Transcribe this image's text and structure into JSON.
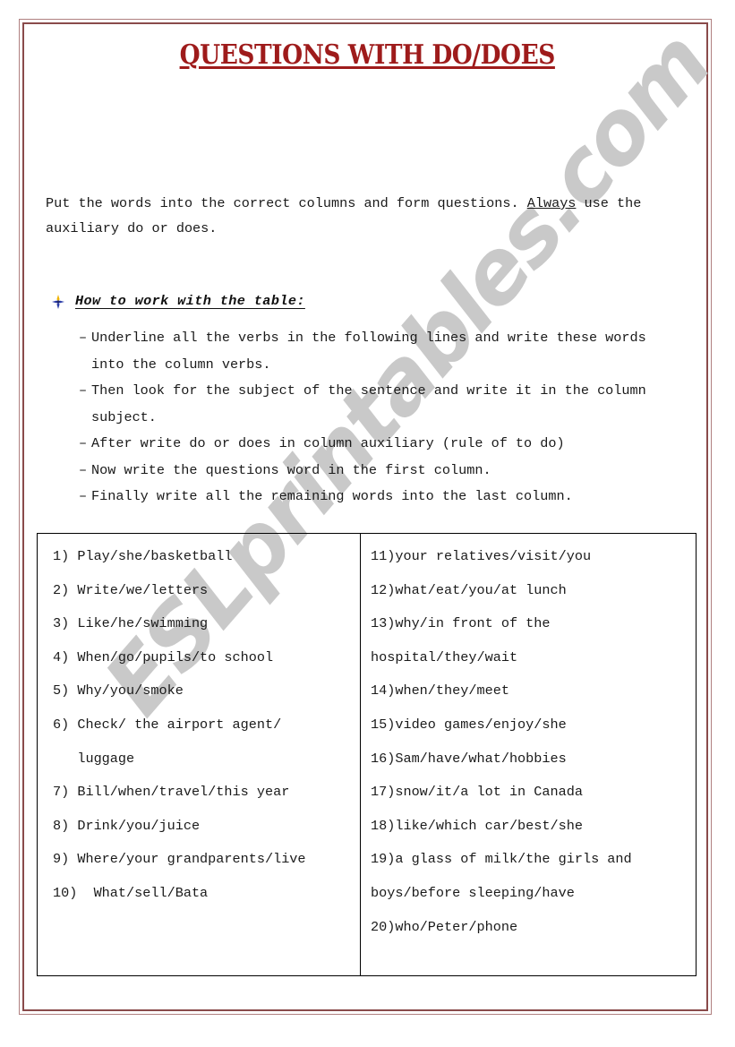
{
  "document": {
    "title": "QUESTIONS WITH DO/DOES",
    "title_color": "#9e1b1b",
    "border_color": "#8a4b4b"
  },
  "watermark": {
    "text": "ESLprintables.com",
    "color": "#c9c9c9"
  },
  "intro": {
    "part1": "Put the words into the correct columns and form questions. ",
    "emphasis": "Always",
    "part2": " use the auxiliary do or does."
  },
  "howto": {
    "bullet_icon": "star-bullet-icon",
    "heading": "How to work with the table:",
    "dash": "–",
    "items": [
      "Underline all the verbs in the following lines and write these words into the column verbs.",
      "Then look for the subject of the sentence and write it in the column subject.",
      "After write do or does in column auxiliary (rule of to do)",
      "Now write the questions word in the first column.",
      "Finally write all the remaining words into the last column."
    ]
  },
  "exercise_table": {
    "left_column": [
      "1) Play/she/basketball",
      "2) Write/we/letters",
      "3) Like/he/swimming",
      "4) When/go/pupils/to school",
      "5) Why/you/smoke",
      "6) Check/ the airport agent/",
      "   luggage",
      "7) Bill/when/travel/this year",
      "8) Drink/you/juice",
      "9) Where/your grandparents/live",
      "10)  What/sell/Bata"
    ],
    "right_column": [
      "11)your relatives/visit/you",
      "12)what/eat/you/at lunch",
      "13)why/in front of the",
      "hospital/they/wait",
      "14)when/they/meet",
      "15)video games/enjoy/she",
      "16)Sam/have/what/hobbies",
      "17)snow/it/a lot in Canada",
      "18)like/which car/best/she",
      "19)a glass of milk/the girls and",
      "boys/before sleeping/have",
      "20)who/Peter/phone"
    ]
  }
}
